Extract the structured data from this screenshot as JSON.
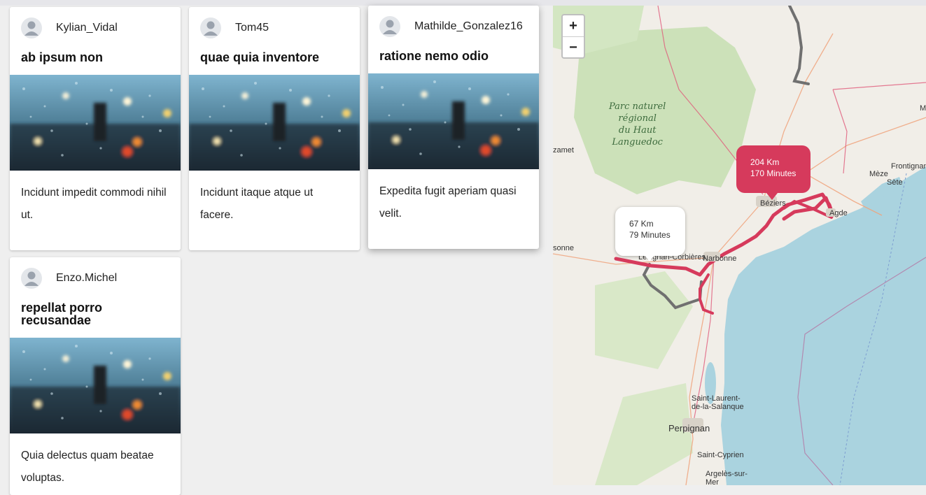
{
  "cards": [
    {
      "username": "Kylian_Vidal",
      "title": "ab ipsum non",
      "text": "Incidunt impedit commodi nihil ut."
    },
    {
      "username": "Tom45",
      "title": "quae quia inventore",
      "text": "Incidunt itaque atque ut facere."
    },
    {
      "username": "Mathilde_Gonzalez16",
      "title": "ratione nemo odio",
      "text": "Expedita fugit aperiam quasi velit."
    },
    {
      "username": "Enzo.Michel",
      "title": "repellat porro recusandae",
      "text": "Quia delectus quam beatae voluptas."
    }
  ],
  "map": {
    "zoom_in": "+",
    "zoom_out": "−",
    "route_a": {
      "distance": "67 Km",
      "duration": "79 Minutes"
    },
    "route_b": {
      "distance": "204 Km",
      "duration": "170 Minutes"
    },
    "park_label": [
      "Parc naturel",
      "régional",
      "du Haut",
      "Languedoc"
    ],
    "places": {
      "zamet": "zamet",
      "mede": "Mèze",
      "frontignan": "Frontignan",
      "sete": "Sète",
      "beziers": "Béziers",
      "agde": "Agde",
      "sonne": "sonne",
      "lezignan": "Lézignan-Corbières",
      "narbonne": "Narbonne",
      "saint_laurent": "Saint-Laurent-\nde-la-Salanque",
      "perpignan": "Perpignan",
      "saint_cyprien": "Saint-Cyprien",
      "argeles": "Argelès-sur-\nMer",
      "m": "M"
    },
    "colors": {
      "route_primary": "#d63a5c",
      "route_alt": "#707070",
      "sea": "#aad3df",
      "land": "#f1eee8",
      "park": "#c8dfb4"
    }
  }
}
